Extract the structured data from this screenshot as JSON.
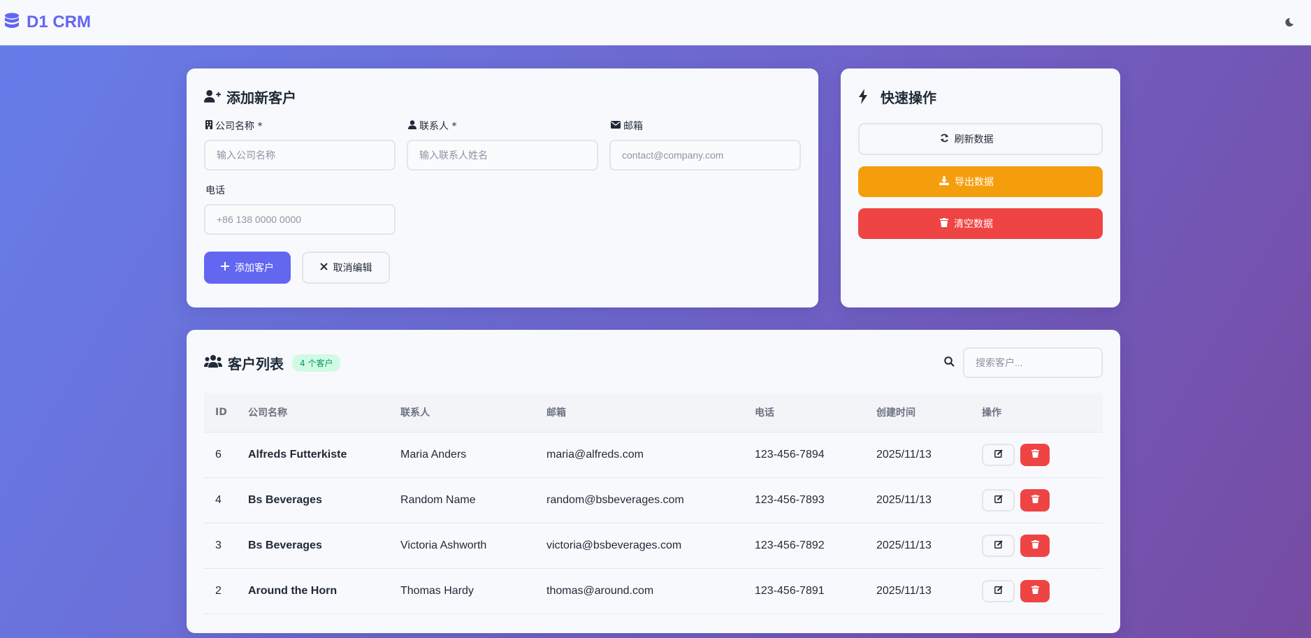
{
  "app": {
    "title": "D1 CRM",
    "theme_toggle_icon": "moon-icon"
  },
  "colors": {
    "primary": "#6366f1",
    "warning": "#f59e0b",
    "danger": "#ef4444",
    "success_badge_bg": "#d1fae5",
    "success_badge_text": "#059669"
  },
  "add_form": {
    "title": "添加新客户",
    "title_icon": "user-plus-icon",
    "fields": {
      "company": {
        "label": "公司名称 *",
        "icon": "building-icon",
        "placeholder": "输入公司名称",
        "value": ""
      },
      "contact": {
        "label": "联系人 *",
        "icon": "user-icon",
        "placeholder": "输入联系人姓名",
        "value": ""
      },
      "email": {
        "label": "邮箱",
        "icon": "envelope-icon",
        "placeholder": "contact@company.com",
        "value": ""
      },
      "phone": {
        "label": "电话",
        "placeholder": "+86 138 0000 0000",
        "value": ""
      }
    },
    "submit_label": "添加客户",
    "cancel_label": "取消编辑"
  },
  "quick_actions": {
    "title": "快速操作",
    "title_icon": "bolt-icon",
    "refresh_label": "刷新数据",
    "export_label": "导出数据",
    "clear_label": "清空数据"
  },
  "customer_list": {
    "title": "客户列表",
    "title_icon": "users-icon",
    "count_badge": "4 个客户",
    "search": {
      "placeholder": "搜索客户...",
      "value": ""
    },
    "columns": [
      "ID",
      "公司名称",
      "联系人",
      "邮箱",
      "电话",
      "创建时间",
      "操作"
    ],
    "rows": [
      {
        "id": "6",
        "company": "Alfreds Futterkiste",
        "contact": "Maria Anders",
        "email": "maria@alfreds.com",
        "phone": "123-456-7894",
        "created": "2025/11/13"
      },
      {
        "id": "4",
        "company": "Bs Beverages",
        "contact": "Random Name",
        "email": "random@bsbeverages.com",
        "phone": "123-456-7893",
        "created": "2025/11/13"
      },
      {
        "id": "3",
        "company": "Bs Beverages",
        "contact": "Victoria Ashworth",
        "email": "victoria@bsbeverages.com",
        "phone": "123-456-7892",
        "created": "2025/11/13"
      },
      {
        "id": "2",
        "company": "Around the Horn",
        "contact": "Thomas Hardy",
        "email": "thomas@around.com",
        "phone": "123-456-7891",
        "created": "2025/11/13"
      }
    ]
  }
}
